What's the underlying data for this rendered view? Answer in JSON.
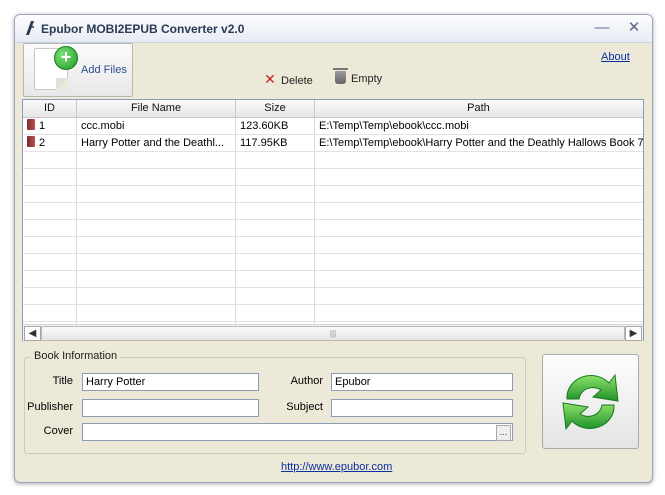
{
  "window": {
    "title": "Epubor MOBI2EPUB Converter v2.0"
  },
  "toolbar": {
    "add_files_label": "Add Files",
    "delete_label": "Delete",
    "empty_label": "Empty",
    "about_label": "About"
  },
  "file_list": {
    "columns": [
      "ID",
      "File Name",
      "Size",
      "Path"
    ],
    "rows": [
      {
        "id": "1",
        "file_name": "ccc.mobi",
        "size": "123.60KB",
        "path": "E:\\Temp\\Temp\\ebook\\ccc.mobi"
      },
      {
        "id": "2",
        "file_name": "Harry Potter and the Deathl...",
        "size": "117.95KB",
        "path": "E:\\Temp\\Temp\\ebook\\Harry Potter and the Deathly Hallows Book 7..."
      }
    ]
  },
  "book_info": {
    "legend": "Book Information",
    "title_label": "Title",
    "title_value": "Harry Potter",
    "author_label": "Author",
    "author_value": "Epubor",
    "publisher_label": "Publisher",
    "publisher_value": "",
    "subject_label": "Subject",
    "subject_value": "",
    "cover_label": "Cover",
    "cover_value": "",
    "browse_label": "..."
  },
  "footer": {
    "link_text": "http://www.epubor.com"
  },
  "colors": {
    "accent_green": "#2aa52d",
    "link_blue": "#0c2fa0",
    "window_bg": "#ece9d8"
  },
  "icons": [
    "app-icon",
    "minimize-icon",
    "close-icon",
    "add-files-icon",
    "delete-icon",
    "trash-icon",
    "book-icon",
    "convert-icon"
  ]
}
